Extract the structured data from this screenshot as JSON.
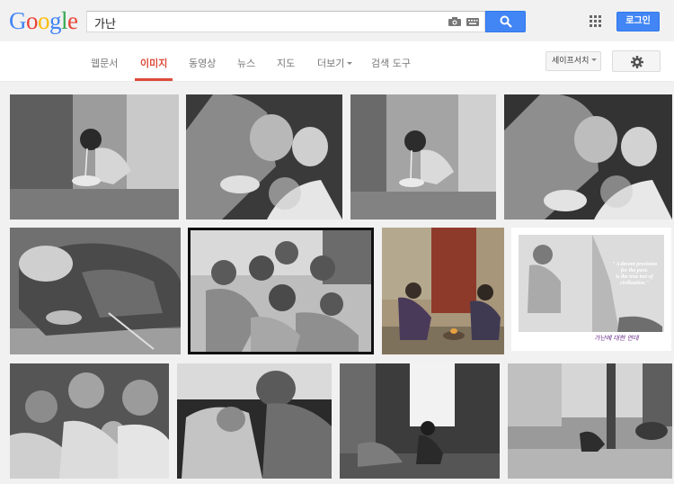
{
  "header": {
    "logo": {
      "letters": [
        "G",
        "o",
        "o",
        "g",
        "l",
        "e"
      ],
      "colors": [
        "#4285f4",
        "#ea4335",
        "#fbbc05",
        "#4285f4",
        "#34a853",
        "#ea4335"
      ]
    },
    "search": {
      "query": "가난"
    },
    "login_label": "로그인"
  },
  "nav": {
    "tabs": [
      {
        "label": "웹문서"
      },
      {
        "label": "이미지"
      },
      {
        "label": "동영상"
      },
      {
        "label": "뉴스"
      },
      {
        "label": "지도"
      },
      {
        "label": "더보기"
      },
      {
        "label": "검색 도구"
      }
    ],
    "active_tab": "이미지",
    "safesearch_label": "세이프서치"
  },
  "colors": {
    "accent_blue": "#4285f4",
    "active_red": "#dd4b39"
  },
  "results": {
    "thumb7_quote": [
      "\" A decent provision",
      "for the poor.",
      "is the true test of",
      "civilization.\""
    ],
    "thumb7_signature": "가난에 대한 연대"
  }
}
